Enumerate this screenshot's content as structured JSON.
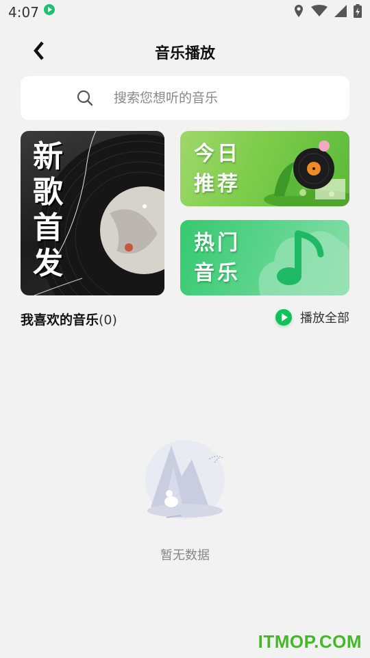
{
  "status_bar": {
    "time": "4:07",
    "icons": [
      "app-play-icon",
      "location-icon",
      "wifi-icon",
      "signal-icon",
      "battery-icon"
    ]
  },
  "header": {
    "title": "音乐播放",
    "back_icon": "back-chevron-icon"
  },
  "search": {
    "placeholder": "搜索您想听的音乐",
    "value": ""
  },
  "cards": {
    "new_songs": {
      "label": "新歌首发",
      "chars": [
        "新",
        "歌",
        "首",
        "发"
      ]
    },
    "today_recommend": {
      "line1": "今日",
      "line2": "推荐"
    },
    "hot_music": {
      "line1": "热门",
      "line2": "音乐"
    }
  },
  "favorites": {
    "title": "我喜欢的音乐",
    "count": "(0)",
    "play_all_label": "播放全部"
  },
  "empty_state": {
    "message": "暂无数据"
  },
  "watermark": "ITMOP.COM",
  "colors": {
    "accent": "#10c15a",
    "background": "#f2f2f2",
    "watermark": "#43b829"
  }
}
